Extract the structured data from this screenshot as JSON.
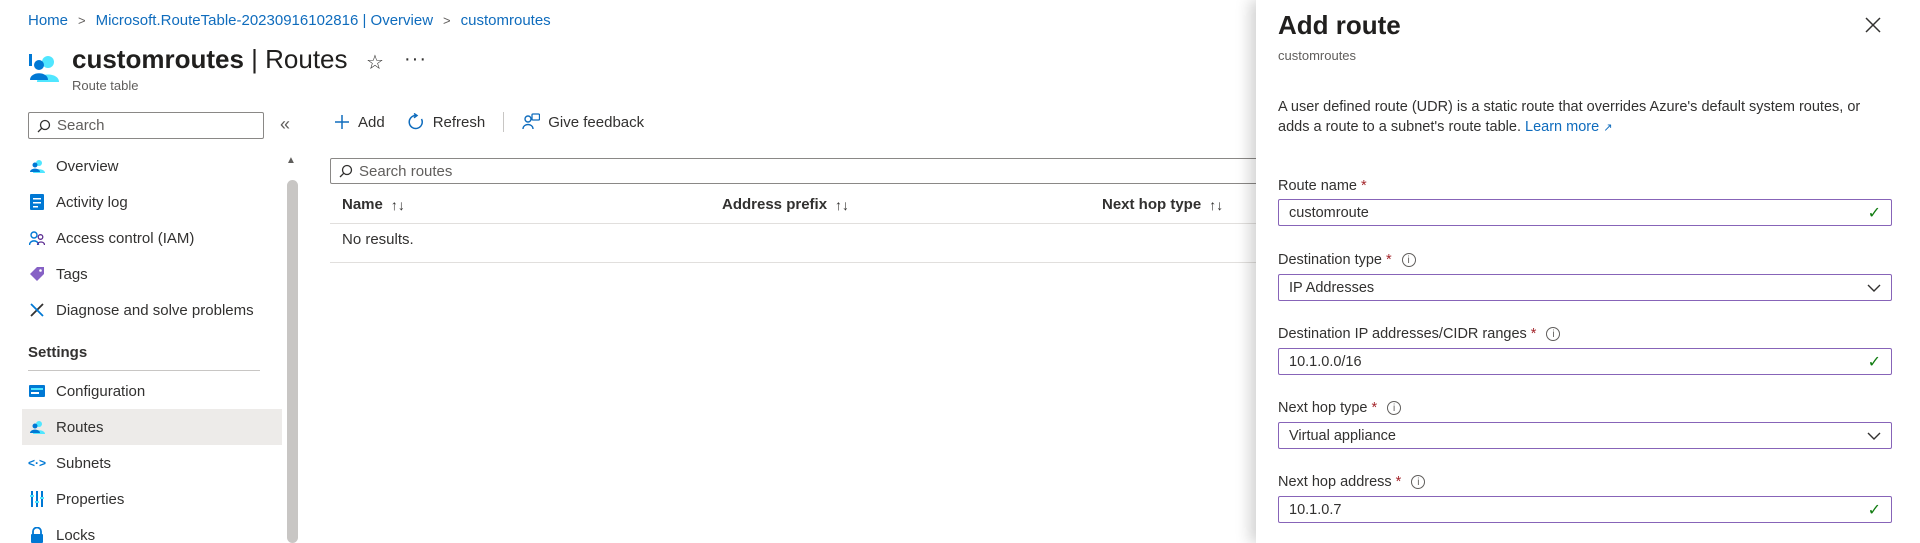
{
  "breadcrumb": {
    "items": [
      "Home",
      "Microsoft.RouteTable-20230916102816 | Overview",
      "customroutes"
    ]
  },
  "resource": {
    "name": "customroutes",
    "section": "| Routes",
    "type": "Route table",
    "favorite_icon": "star-icon",
    "more_icon": "ellipsis-icon"
  },
  "nav": {
    "search_placeholder": "Search",
    "items": [
      {
        "label": "Overview",
        "icon": "route-table-icon"
      },
      {
        "label": "Activity log",
        "icon": "activity-log-icon"
      },
      {
        "label": "Access control (IAM)",
        "icon": "people-icon"
      },
      {
        "label": "Tags",
        "icon": "tag-icon"
      },
      {
        "label": "Diagnose and solve problems",
        "icon": "wrench-icon"
      }
    ],
    "settings_header": "Settings",
    "settings_items": [
      {
        "label": "Configuration",
        "icon": "configuration-icon"
      },
      {
        "label": "Routes",
        "icon": "routes-icon",
        "active": true
      },
      {
        "label": "Subnets",
        "icon": "subnets-icon"
      },
      {
        "label": "Properties",
        "icon": "properties-icon"
      },
      {
        "label": "Locks",
        "icon": "lock-icon"
      }
    ]
  },
  "toolbar": {
    "add_label": "Add",
    "refresh_label": "Refresh",
    "feedback_label": "Give feedback"
  },
  "routes_table": {
    "search_placeholder": "Search routes",
    "columns": [
      "Name",
      "Address prefix",
      "Next hop type"
    ],
    "empty_text": "No results."
  },
  "panel": {
    "title": "Add route",
    "subtitle": "customroutes",
    "description": "A user defined route (UDR) is a static route that overrides Azure's default system routes, or adds a route to a subnet's route table.",
    "learn_more": "Learn more",
    "fields": {
      "route_name": {
        "label": "Route name",
        "value": "customroute"
      },
      "destination_type": {
        "label": "Destination type",
        "value": "IP Addresses"
      },
      "destination_ip": {
        "label": "Destination IP addresses/CIDR ranges",
        "value": "10.1.0.0/16"
      },
      "next_hop_type": {
        "label": "Next hop type",
        "value": "Virtual appliance"
      },
      "next_hop_address": {
        "label": "Next hop address",
        "value": "10.1.0.7"
      }
    },
    "required_marker": "*"
  },
  "colors": {
    "accent": "#0f6cbd",
    "field_border": "#8764b8",
    "valid": "#107c10",
    "required": "#a4262c"
  }
}
